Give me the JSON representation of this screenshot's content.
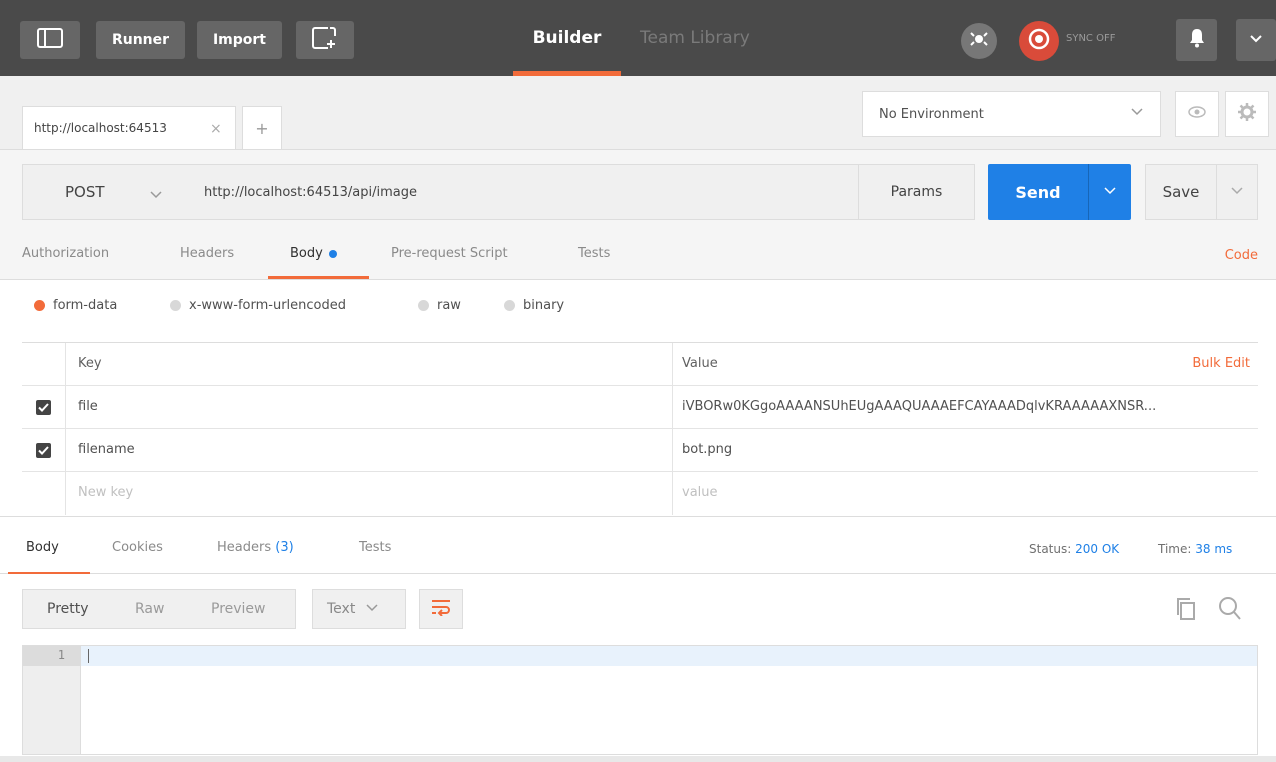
{
  "topbar": {
    "runner_label": "Runner",
    "import_label": "Import",
    "builder_label": "Builder",
    "team_library_label": "Team Library",
    "sync_label": "SYNC OFF",
    "icons": [
      "sidebar-icon",
      "new-window-icon",
      "interceptor-icon",
      "sync-icon",
      "bell-icon",
      "chevron-down-icon"
    ]
  },
  "tabs": {
    "active_tab_label": "http://localhost:64513",
    "close_glyph": "×",
    "new_tab_glyph": "+"
  },
  "environment": {
    "selected": "No Environment"
  },
  "request": {
    "method": "POST",
    "url": "http://localhost:64513/api/image",
    "params_label": "Params",
    "send_label": "Send",
    "save_label": "Save"
  },
  "request_tabs": {
    "authorization": "Authorization",
    "headers": "Headers",
    "body": "Body",
    "pre_request": "Pre-request Script",
    "tests": "Tests",
    "code": "Code"
  },
  "body_types": {
    "form_data": "form-data",
    "urlencoded": "x-www-form-urlencoded",
    "raw": "raw",
    "binary": "binary",
    "selected": "form-data"
  },
  "kv_table": {
    "key_header": "Key",
    "value_header": "Value",
    "bulk_edit": "Bulk Edit",
    "rows": [
      {
        "checked": true,
        "key": "file",
        "value": "iVBORw0KGgoAAAANSUhEUgAAAQUAAAEFCAYAAADqlvKRAAAAAXNSR..."
      },
      {
        "checked": true,
        "key": "filename",
        "value": "bot.png"
      }
    ],
    "new_key_placeholder": "New key",
    "new_value_placeholder": "value"
  },
  "response": {
    "tabs": {
      "body": "Body",
      "cookies": "Cookies",
      "headers": "Headers",
      "headers_count": "(3)",
      "tests": "Tests"
    },
    "status_label": "Status:",
    "status_value": "200 OK",
    "time_label": "Time:",
    "time_value": "38 ms",
    "view_modes": {
      "pretty": "Pretty",
      "raw": "Raw",
      "preview": "Preview"
    },
    "format": "Text",
    "line_number": "1"
  },
  "colors": {
    "accent": "#f26b3a",
    "send_blue": "#1f80e6",
    "topbar": "#4a4a4a"
  }
}
